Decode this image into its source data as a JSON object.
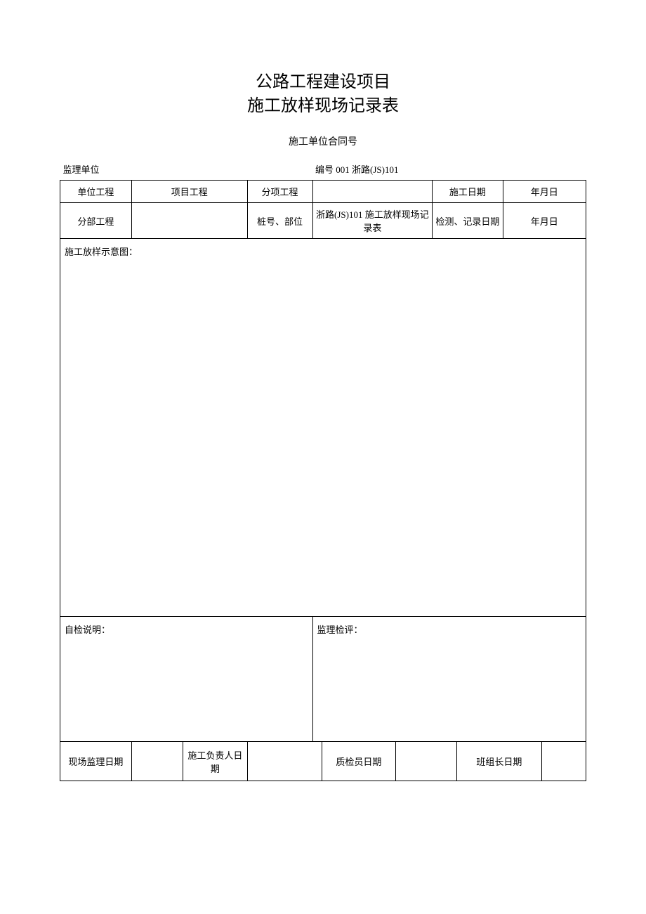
{
  "title": {
    "line1": "公路工程建设项目",
    "line2": "施工放样现场记录表"
  },
  "meta": {
    "contract_line": "施工单位合同号",
    "supervisor_label": "监理单位",
    "serial_label": "编号 001 浙路(JS)101"
  },
  "header_rows": {
    "r1": {
      "c1": "单位工程",
      "c2": "项目工程",
      "c3": "",
      "c4": "分项工程",
      "c5": "",
      "c6": "施工日期",
      "c7": "年月日"
    },
    "r2": {
      "c1": "分部工程",
      "c2": "",
      "c3": "桩号、部位",
      "c4": "浙路(JS)101 施工放样现场记录表",
      "c5": "检测、记录日期",
      "c6": "年月日"
    }
  },
  "diagram_label": "施工放样示意图：",
  "notes": {
    "left": "自检说明：",
    "right": "监理检评："
  },
  "sign": {
    "c1": "现场监理日期",
    "c2": "",
    "c3": "施工负责人日期",
    "c4": "",
    "c5": "质检员日期",
    "c6": "",
    "c7": "班组长日期",
    "c8": ""
  }
}
